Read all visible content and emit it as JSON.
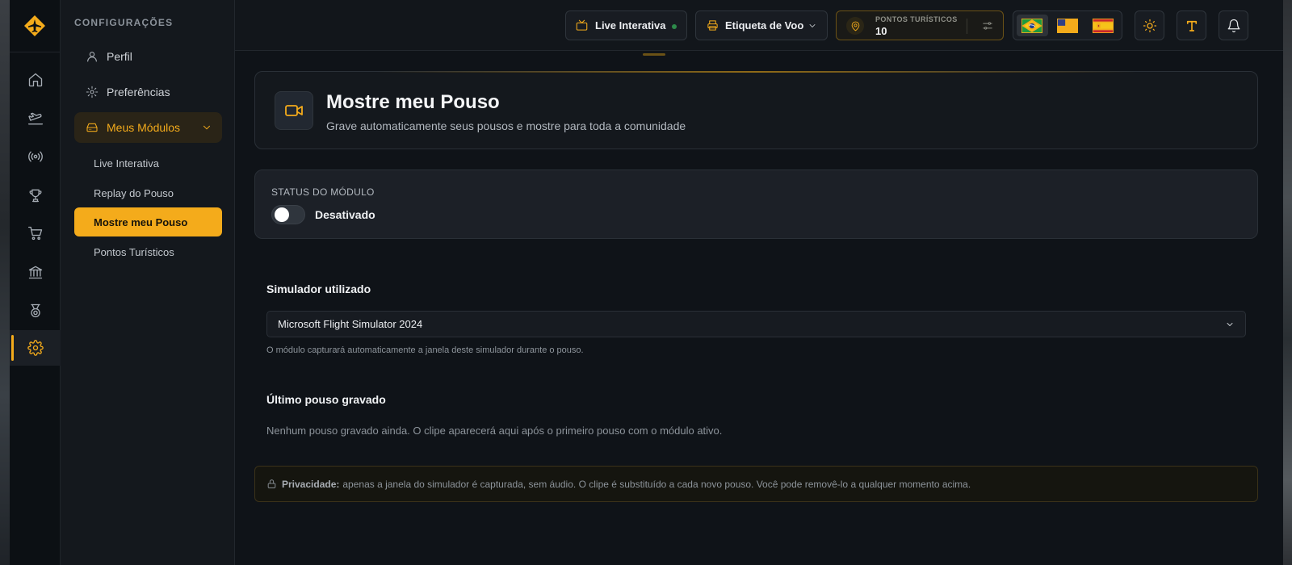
{
  "sidebar": {
    "title": "CONFIGURAÇÕES",
    "items": [
      {
        "label": "Perfil"
      },
      {
        "label": "Preferências"
      }
    ],
    "group": {
      "label": "Meus Módulos"
    },
    "subitems": [
      {
        "label": "Live Interativa"
      },
      {
        "label": "Replay do Pouso"
      },
      {
        "label": "Mostre meu Pouso"
      },
      {
        "label": "Pontos Turísticos"
      }
    ]
  },
  "topbar": {
    "live_label": "Live Interativa",
    "etiqueta_label": "Etiqueta de Voo",
    "points_label": "PONTOS TURÍSTICOS",
    "points_value": "10",
    "languages": [
      "pt-BR",
      "en-US",
      "es-ES"
    ],
    "active_language": "pt-BR"
  },
  "header": {
    "title": "Mostre meu Pouso",
    "subtitle": "Grave automaticamente seus pousos e mostre para toda a comunidade"
  },
  "status": {
    "caption": "STATUS DO MÓDULO",
    "state": "Desativado",
    "enabled": false
  },
  "simulator": {
    "label": "Simulador utilizado",
    "value": "Microsoft Flight Simulator 2024",
    "hint": "O módulo capturará automaticamente a janela deste simulador durante o pouso."
  },
  "last": {
    "title": "Último pouso gravado",
    "empty": "Nenhum pouso gravado ainda. O clipe aparecerá aqui após o primeiro pouso com o módulo ativo."
  },
  "privacy": {
    "label": "Privacidade:",
    "text": "apenas a janela do simulador é capturada, sem áudio. O clipe é substituído a cada novo pouso. Você pode removê-lo a qualquer momento acima."
  },
  "colors": {
    "accent": "#f4ab1b",
    "background": "#0f1318",
    "panel": "#14181d"
  }
}
